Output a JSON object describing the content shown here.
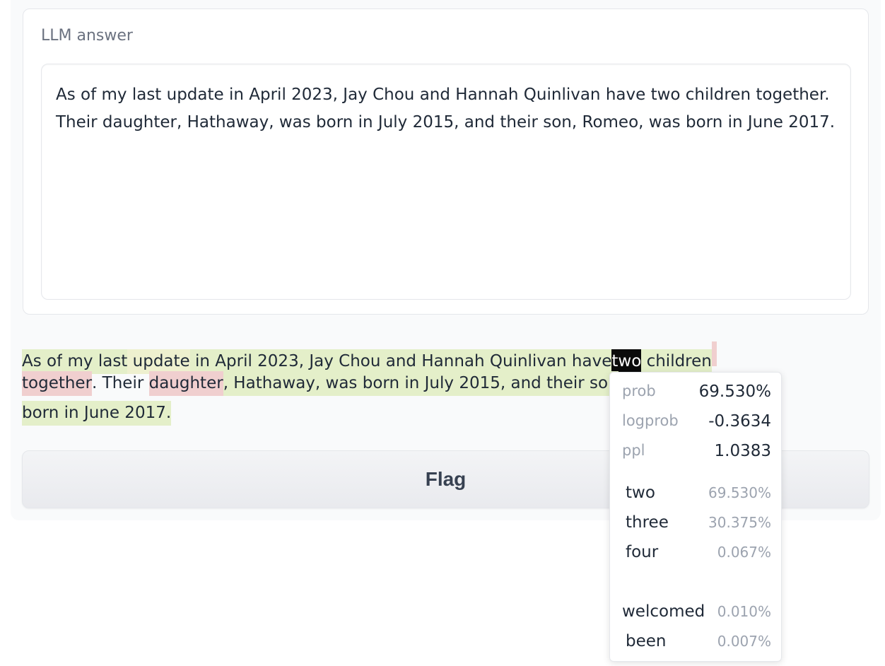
{
  "block_label": "LLM answer",
  "answer_text": "As of my last update in April 2023, Jay Chou and Hannah Quinlivan have two children together. Their daughter, Hathaway, was born in July 2015, and their son, Romeo, was born in June 2017.",
  "tokens": {
    "line1": [
      "As",
      " of",
      " my",
      " last",
      " update",
      " in",
      " April",
      " 2023",
      ",",
      " Jay",
      " Chou",
      " and",
      " Hannah",
      " Quinlivan",
      " have",
      "two",
      " children",
      " "
    ],
    "line2": [
      "together",
      ".",
      " Their",
      " ",
      "daughter",
      ",",
      " Hathaway",
      ",",
      " was",
      " born",
      " in",
      " July",
      " 2015",
      ",",
      " and",
      " their",
      " son"
    ],
    "line3": [
      "born",
      " in",
      " June",
      " 2017",
      "."
    ]
  },
  "token_colors": {
    "green_strong": "#e4efc9",
    "green_light": "#e9f2d3",
    "yellow": "#eef0cf",
    "red": "#f0cfcf",
    "selected": "#0b0b0b"
  },
  "flag_button": "Flag",
  "tooltip": {
    "stats": [
      {
        "key": "prob",
        "value": "69.530%"
      },
      {
        "key": "logprob",
        "value": "-0.3634"
      },
      {
        "key": "ppl",
        "value": "1.0383"
      }
    ],
    "candidates": [
      {
        "token": "two",
        "prob": "69.530%"
      },
      {
        "token": "three",
        "prob": "30.375%"
      },
      {
        "token": "four",
        "prob": "0.067%"
      },
      {
        "token": "",
        "prob": ""
      },
      {
        "token": "welcomed",
        "prob": "0.010%"
      },
      {
        "token": "been",
        "prob": "0.007%"
      }
    ]
  }
}
